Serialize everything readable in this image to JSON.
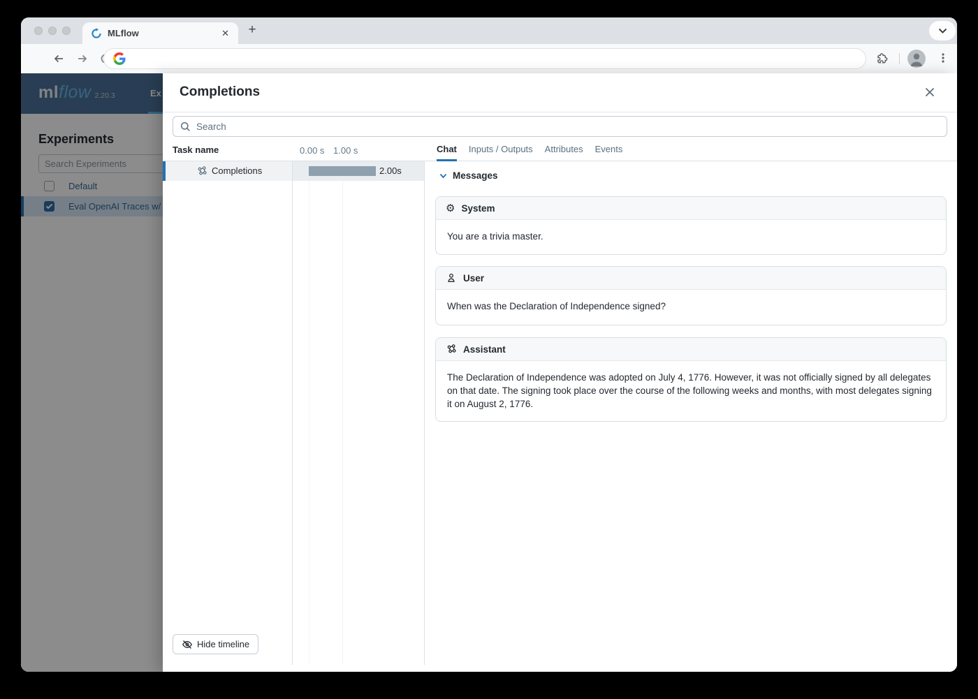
{
  "browser": {
    "tab_title": "MLflow",
    "tab_close_glyph": "✕",
    "new_tab_glyph": "+",
    "url_value": ""
  },
  "app": {
    "logo": {
      "ml": "ml",
      "flow": "flow",
      "version": "2.20.3"
    },
    "nav_partial": "Ex",
    "sidebar": {
      "title": "Experiments",
      "search_placeholder": "Search Experiments",
      "experiments": [
        {
          "label": "Default",
          "checked": false,
          "selected": false
        },
        {
          "label": "Eval OpenAI Traces w/",
          "checked": true,
          "selected": true
        }
      ]
    }
  },
  "modal": {
    "title": "Completions",
    "search_placeholder": "Search",
    "timeline": {
      "column_header": "Task name",
      "tick_labels": [
        "0.00 s",
        "1.00 s"
      ],
      "tasks": [
        {
          "name": "Completions",
          "duration_label": "2.00s",
          "start_s": 0.0,
          "end_s": 2.0
        }
      ],
      "hide_button_label": "Hide timeline"
    },
    "tabs": [
      {
        "label": "Chat",
        "active": true
      },
      {
        "label": "Inputs / Outputs",
        "active": false
      },
      {
        "label": "Attributes",
        "active": false
      },
      {
        "label": "Events",
        "active": false
      }
    ],
    "chat": {
      "section_header": "Messages",
      "messages": [
        {
          "role": "System",
          "icon": "gear-icon",
          "content": "You are a trivia master."
        },
        {
          "role": "User",
          "icon": "user-icon",
          "content": "When was the Declaration of Independence signed?"
        },
        {
          "role": "Assistant",
          "icon": "model-icon",
          "content": "The Declaration of Independence was adopted on July 4, 1776. However, it was not officially signed by all delegates on that date. The signing took place over the course of the following weeks and months, with most delegates signing it on August 2, 1776."
        }
      ]
    }
  },
  "colors": {
    "accent_blue": "#2272B4",
    "header_navy": "#4c729a",
    "bar_gray": "#8fa0af",
    "logo_flow_blue": "#66b5e8"
  }
}
